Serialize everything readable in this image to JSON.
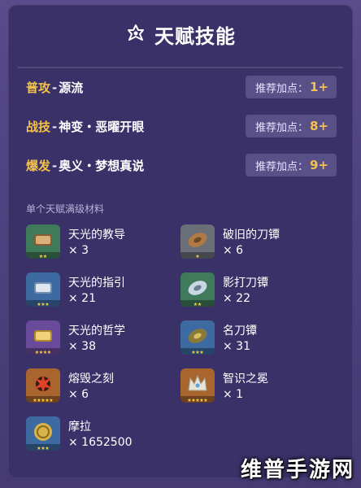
{
  "header": {
    "title": "天赋技能",
    "icon": "talent-emblem-icon"
  },
  "talents": [
    {
      "type": "普攻",
      "name": "源流",
      "rec_label": "推荐加点：",
      "rec_value": "1+"
    },
    {
      "type": "战技",
      "name": "神变・恶曜开眼",
      "rec_label": "推荐加点：",
      "rec_value": "8+"
    },
    {
      "type": "爆发",
      "name": "奥义・梦想真说",
      "rec_label": "推荐加点：",
      "rec_value": "9+"
    }
  ],
  "talent_separator": "-",
  "materials_label": "单个天赋满级材料",
  "materials": [
    {
      "name": "天光的教导",
      "count": "× 3",
      "icon": "scroll-teachings-icon",
      "rarity": 2,
      "color": "#3f7a5a"
    },
    {
      "name": "破旧的刀镡",
      "count": "× 6",
      "icon": "old-handguard-icon",
      "rarity": 1,
      "color": "#6b6f78"
    },
    {
      "name": "天光的指引",
      "count": "× 21",
      "icon": "scroll-guide-icon",
      "rarity": 3,
      "color": "#3d6aa0"
    },
    {
      "name": "影打刀镡",
      "count": "× 22",
      "icon": "kageuchi-handguard-icon",
      "rarity": 2,
      "color": "#3f7a5a"
    },
    {
      "name": "天光的哲学",
      "count": "× 38",
      "icon": "scroll-philosophies-icon",
      "rarity": 4,
      "color": "#6a4a9a"
    },
    {
      "name": "名刀镡",
      "count": "× 31",
      "icon": "famed-handguard-icon",
      "rarity": 3,
      "color": "#3d6aa0"
    },
    {
      "name": "熔毁之刻",
      "count": "× 6",
      "icon": "molten-moment-icon",
      "rarity": 5,
      "color": "#a8662e"
    },
    {
      "name": "智识之冕",
      "count": "× 1",
      "icon": "crown-of-insight-icon",
      "rarity": 5,
      "color": "#a8662e"
    },
    {
      "name": "摩拉",
      "count": "× 1652500",
      "icon": "mora-coin-icon",
      "rarity": 3,
      "color": "#3d6aa0"
    }
  ],
  "watermark": "维普手游网",
  "colors": {
    "accent_gold": "#f5c24a",
    "panel": "#3a3168",
    "rec_box": "#5a5088"
  }
}
